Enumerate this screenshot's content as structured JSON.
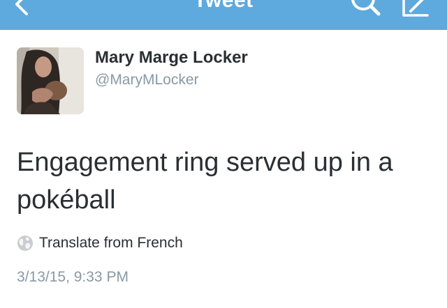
{
  "header": {
    "title": "Tweet",
    "color": "#5ea9dd",
    "icons": [
      "back-icon",
      "search-icon",
      "compose-icon"
    ]
  },
  "tweet": {
    "display_name": "Mary Marge Locker",
    "username": "@MaryMLocker",
    "text": "Engagement ring served up in a pokéball",
    "translate_label": "Translate from French",
    "timestamp": "3/13/15, 9:33 PM"
  }
}
